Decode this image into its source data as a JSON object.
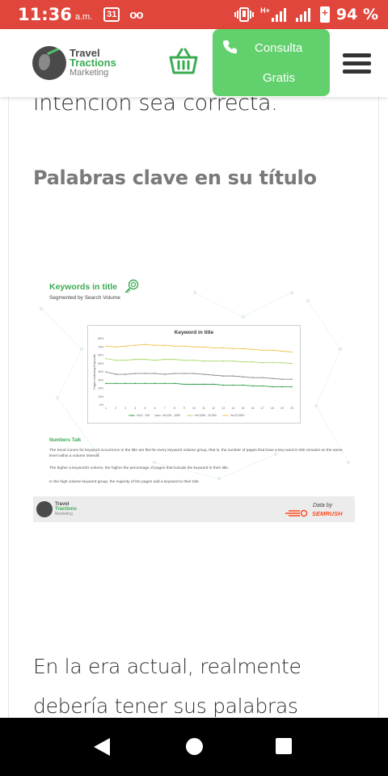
{
  "status_bar": {
    "time": "11:36",
    "ampm": "a.m.",
    "calendar_day": "31",
    "voicemail": "oo",
    "network": "H+",
    "battery_pct": "94 %",
    "bg_color": "#e0463b"
  },
  "header": {
    "logo": {
      "line1": "Travel",
      "line2": "Tractions",
      "line3": "Marketing"
    },
    "cart_icon": "basket-icon",
    "cta": {
      "line1": "Consulta",
      "line2": "Gratis",
      "icon": "phone-icon",
      "color": "#62d06d"
    },
    "menu_icon": "hamburger-icon"
  },
  "article": {
    "para_top": "intención sea correcta.",
    "heading": "Palabras clave en su título",
    "para_bottom_line1": "En la era actual, realmente",
    "para_bottom_line2": "debería tener sus palabras"
  },
  "infographic": {
    "title": "Keywords in title",
    "subtitle": "Segmented by Search Volume",
    "numbers_talk_title": "Numbers Talk",
    "p1": "The trend curves for keyword occurrence in the title are flat for every keyword volume group, that is, the number of pages that have a key-word in title remains on the same level within a volume interval.",
    "p2": "The higher a keyword's volume, the higher the percentage of pages that include the keyword in their title.",
    "p3": "In the high volume keyword group, the majority of the pages add a keyword to their title.",
    "footer": {
      "logo_line1": "Travel",
      "logo_line2": "Tractions",
      "logo_line3": "Marketing",
      "data_by": "Data by",
      "brand": "SEMRUSH"
    }
  },
  "chart_data": {
    "type": "line",
    "title": "Keyword in title",
    "xlabel": "",
    "ylabel": "Pages containing Keywords",
    "x": [
      1,
      2,
      3,
      4,
      5,
      6,
      7,
      8,
      9,
      10,
      11,
      12,
      13,
      14,
      15,
      16,
      17,
      18,
      19,
      20
    ],
    "ylim": [
      0,
      80
    ],
    "yticks": [
      "0%",
      "10%",
      "20%",
      "30%",
      "40%",
      "50%",
      "60%",
      "70%",
      "80%"
    ],
    "series": [
      {
        "name": "Vol 0 - 100",
        "color": "#2e9e48",
        "values": [
          26,
          26,
          26,
          26,
          26,
          26,
          26,
          26,
          25,
          25,
          25,
          25,
          24,
          24,
          24,
          23,
          23,
          22,
          22,
          22
        ]
      },
      {
        "name": "Vol 100 - 1000",
        "color": "#888888",
        "values": [
          40,
          37,
          37,
          38,
          38,
          38,
          37,
          38,
          38,
          38,
          37,
          36,
          35,
          35,
          34,
          33,
          33,
          32,
          31,
          31
        ]
      },
      {
        "name": "Vol 1000 - 10 000",
        "color": "#a8d86a",
        "values": [
          56,
          54,
          54,
          55,
          55,
          54,
          55,
          55,
          54,
          54,
          53,
          53,
          53,
          53,
          52,
          52,
          51,
          51,
          51,
          50
        ]
      },
      {
        "name": "Vol 10 000+",
        "color": "#f2c14e",
        "values": [
          71,
          70,
          71,
          72,
          73,
          72,
          72,
          71,
          71,
          70,
          70,
          69,
          69,
          68,
          68,
          67,
          66,
          66,
          65,
          64
        ]
      }
    ],
    "grid": false,
    "legend": "bottom"
  },
  "navbar": {
    "back_icon": "back-triangle-icon",
    "home_icon": "home-circle-icon",
    "recents_icon": "recents-square-icon"
  }
}
